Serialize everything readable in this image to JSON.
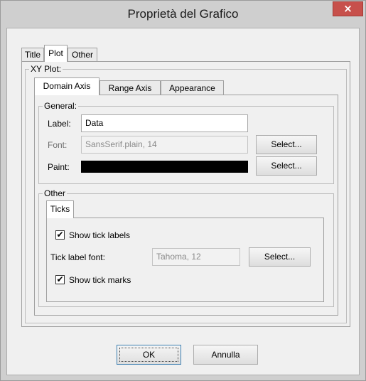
{
  "window": {
    "title": "Proprietà del Grafico",
    "close_glyph": "×"
  },
  "tabs": [
    "Title",
    "Plot",
    "Other"
  ],
  "xy_plot": {
    "group_title": "XY Plot:",
    "tabs": [
      "Domain Axis",
      "Range Axis",
      "Appearance"
    ],
    "general": {
      "group_title": "General:",
      "label_caption": "Label:",
      "label_value": "Data",
      "font_caption": "Font:",
      "font_value": "SansSerif.plain, 14",
      "font_select": "Select...",
      "paint_caption": "Paint:",
      "paint_color": "#000000",
      "paint_select": "Select..."
    },
    "other": {
      "group_title": "Other",
      "tab": "Ticks",
      "show_tick_labels": "Show tick labels",
      "show_tick_labels_checked": true,
      "tick_label_font_caption": "Tick label font:",
      "tick_label_font_value": "Tahoma, 12",
      "tick_label_font_select": "Select...",
      "show_tick_marks": "Show tick marks",
      "show_tick_marks_checked": true
    }
  },
  "footer": {
    "ok": "OK",
    "cancel": "Annulla"
  },
  "colors": {
    "close_button": "#c7504b",
    "default_button_border": "#3c7fb1"
  }
}
